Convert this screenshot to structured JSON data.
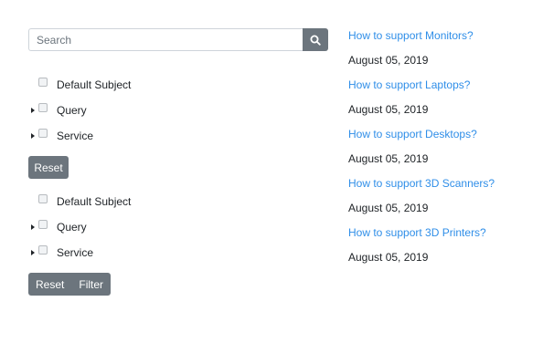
{
  "search": {
    "placeholder": "Search",
    "button_icon": "search-icon"
  },
  "filter_panel_1": {
    "items": [
      {
        "label": "Default Subject",
        "expandable": false
      },
      {
        "label": "Query",
        "expandable": true
      },
      {
        "label": "Service",
        "expandable": true
      }
    ],
    "reset_label": "Reset"
  },
  "filter_panel_2": {
    "items": [
      {
        "label": "Default Subject",
        "expandable": false
      },
      {
        "label": "Query",
        "expandable": true
      },
      {
        "label": "Service",
        "expandable": true
      }
    ],
    "reset_label": "Reset",
    "filter_label": "Filter"
  },
  "articles": [
    {
      "title": "How to support Monitors?",
      "date": "August 05, 2019"
    },
    {
      "title": "How to support Laptops?",
      "date": "August 05, 2019"
    },
    {
      "title": "How to support Desktops?",
      "date": "August 05, 2019"
    },
    {
      "title": "How to support 3D Scanners?",
      "date": "August 05, 2019"
    },
    {
      "title": "How to support 3D Printers?",
      "date": "August 05, 2019"
    }
  ],
  "colors": {
    "button_bg": "#6c757d",
    "link": "#2f8ee8",
    "text": "#212529"
  }
}
